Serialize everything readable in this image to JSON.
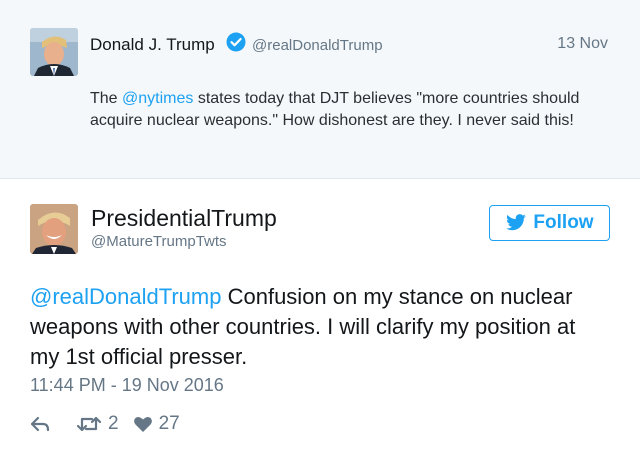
{
  "quoted_tweet": {
    "author_name": "Donald J. Trump",
    "handle": "@realDonaldTrump",
    "date": "13 Nov",
    "text_before": "The ",
    "mention": "@nytimes",
    "text_after": " states today that DJT believes \"more countries should acquire nuclear weapons.\" How dishonest are they. I never said this!"
  },
  "main_tweet": {
    "author_name": "PresidentialTrump",
    "handle": "@MatureTrumpTwts",
    "follow_label": "Follow",
    "mention": "@realDonaldTrump",
    "text_after": " Confusion on my stance on nuclear weapons with other countries. I will clarify my position at my 1st official presser.",
    "timestamp": "11:44 PM - 19 Nov 2016",
    "retweets": "2",
    "likes": "27"
  },
  "colors": {
    "accent": "#1da1f2",
    "quoted_bg": "#f5f8fa",
    "muted": "#657786"
  },
  "icons": [
    "verified-badge-icon",
    "twitter-bird-icon",
    "reply-icon",
    "retweet-icon",
    "heart-icon"
  ]
}
